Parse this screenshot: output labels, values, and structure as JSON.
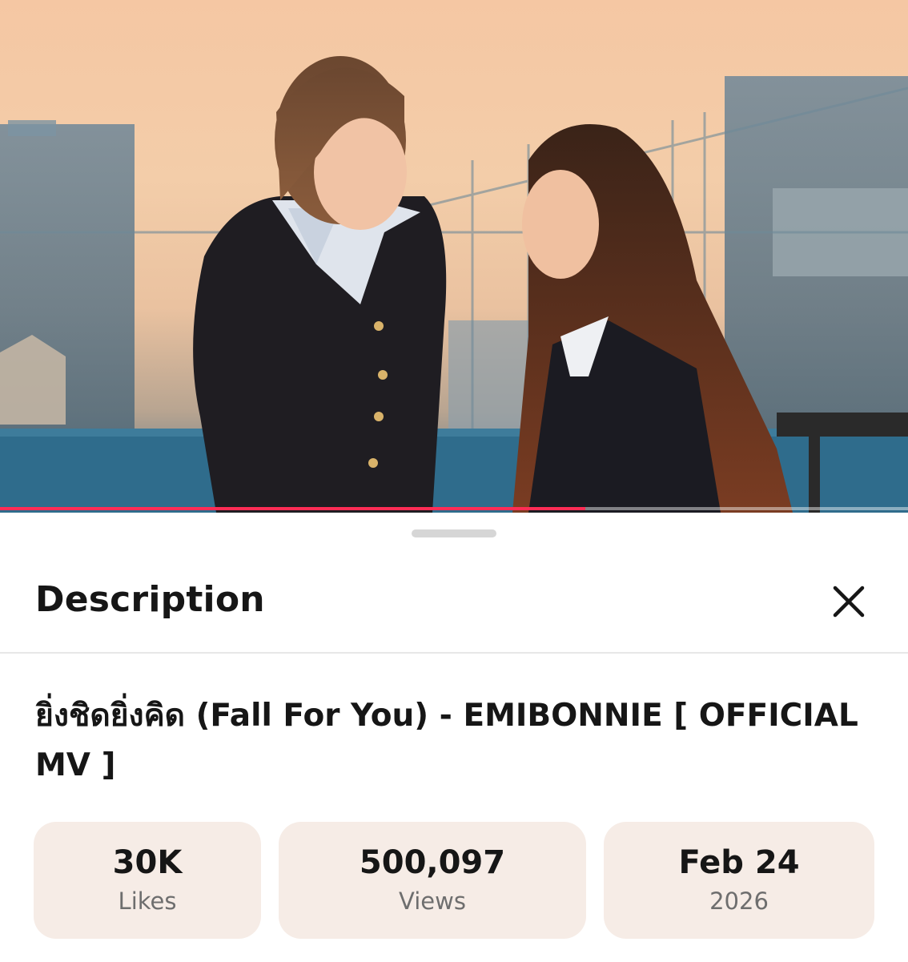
{
  "video": {
    "thumbnail_icon": "music-video-still",
    "progress_fraction": 0.645,
    "progress_color": "#fe2c55"
  },
  "sheet": {
    "title": "Description",
    "close_icon": "close-icon",
    "video_title": "ยิ่งชิดยิ่งคิด (Fall For You) - EMIBONNIE [ OFFICIAL MV ]"
  },
  "stats": [
    {
      "value": "30K",
      "label": "Likes"
    },
    {
      "value": "500,097",
      "label": "Views"
    },
    {
      "value": "Feb 24",
      "label": "2026"
    }
  ],
  "colors": {
    "stat_bg": "#f6ece6",
    "accent": "#fe2c55"
  }
}
